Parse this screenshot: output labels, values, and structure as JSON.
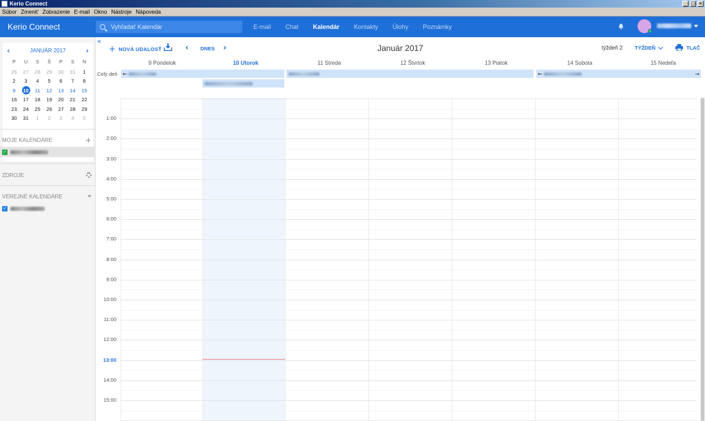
{
  "window": {
    "title": "Kerio Connect"
  },
  "menu": [
    "Súbor",
    "Zmeniť",
    "Zobrazenie",
    "E-mail",
    "Okno",
    "Nástroje",
    "Nápoveda"
  ],
  "header": {
    "brand": "Kerio Connect",
    "search_placeholder": "Vyhľadať Kalendár",
    "tabs": [
      {
        "label": "E-mail",
        "active": false
      },
      {
        "label": "Chat",
        "active": false
      },
      {
        "label": "Kalendár",
        "active": true
      },
      {
        "label": "Kontakty",
        "active": false
      },
      {
        "label": "Úlohy",
        "active": false
      },
      {
        "label": "Poznámky",
        "active": false
      }
    ]
  },
  "minical": {
    "title": "JANUÁR 2017",
    "dow": [
      "P",
      "U",
      "S",
      "Š",
      "P",
      "S",
      "N"
    ],
    "weeks": [
      [
        {
          "d": "26",
          "m": true
        },
        {
          "d": "27",
          "m": true
        },
        {
          "d": "28",
          "m": true
        },
        {
          "d": "29",
          "m": true
        },
        {
          "d": "30",
          "m": true
        },
        {
          "d": "31",
          "m": true
        },
        {
          "d": "1"
        }
      ],
      [
        {
          "d": "2"
        },
        {
          "d": "3"
        },
        {
          "d": "4"
        },
        {
          "d": "5"
        },
        {
          "d": "6"
        },
        {
          "d": "7"
        },
        {
          "d": "8"
        }
      ],
      [
        {
          "d": "9",
          "w": true
        },
        {
          "d": "10",
          "today": true
        },
        {
          "d": "11",
          "w": true
        },
        {
          "d": "12",
          "w": true
        },
        {
          "d": "13",
          "w": true
        },
        {
          "d": "14",
          "w": true
        },
        {
          "d": "15",
          "w": true
        }
      ],
      [
        {
          "d": "16"
        },
        {
          "d": "17"
        },
        {
          "d": "18"
        },
        {
          "d": "19"
        },
        {
          "d": "20"
        },
        {
          "d": "21"
        },
        {
          "d": "22"
        }
      ],
      [
        {
          "d": "23"
        },
        {
          "d": "24"
        },
        {
          "d": "25"
        },
        {
          "d": "26"
        },
        {
          "d": "27"
        },
        {
          "d": "28"
        },
        {
          "d": "29"
        }
      ],
      [
        {
          "d": "30"
        },
        {
          "d": "31"
        },
        {
          "d": "1",
          "m": true
        },
        {
          "d": "2",
          "m": true
        },
        {
          "d": "3",
          "m": true
        },
        {
          "d": "4",
          "m": true
        },
        {
          "d": "5",
          "m": true
        }
      ]
    ]
  },
  "sidebar": {
    "my_calendars": "MOJE KALENDÁRE",
    "resources": "ZDROJE",
    "public_calendars": "VEREJNÉ KALENDÁRE",
    "colors": {
      "my_calendar": "#2aa84a",
      "public_calendar": "#2e86de"
    }
  },
  "toolbar": {
    "new_event": "NOVÁ UDALOSŤ",
    "today": "DNES",
    "month_title": "Január 2017",
    "week_number": "týždeň 2",
    "view": "TÝŽDEŇ",
    "print": "TLAČ"
  },
  "days": [
    {
      "label": "9 Pondelok",
      "current": false
    },
    {
      "label": "10 Utorok",
      "current": true
    },
    {
      "label": "11 Streda",
      "current": false
    },
    {
      "label": "12 Štvrtok",
      "current": false
    },
    {
      "label": "13 Piatok",
      "current": false
    },
    {
      "label": "14 Sobota",
      "current": false
    },
    {
      "label": "15 Nedeľa",
      "current": false
    }
  ],
  "allday_label": "Celý deň",
  "hours": [
    "1:00",
    "2:00",
    "3:00",
    "4:00",
    "5:00",
    "6:00",
    "7:00",
    "8:00",
    "9:00",
    "10:00",
    "11:00",
    "12:00",
    "13:00",
    "14:00",
    "15:00"
  ],
  "current_hour": "13:00",
  "colors": {
    "accent": "#1f6fd8",
    "event": "#cfe3f9",
    "today_column": "#eef5fd",
    "now_line": "#f08a8a"
  }
}
